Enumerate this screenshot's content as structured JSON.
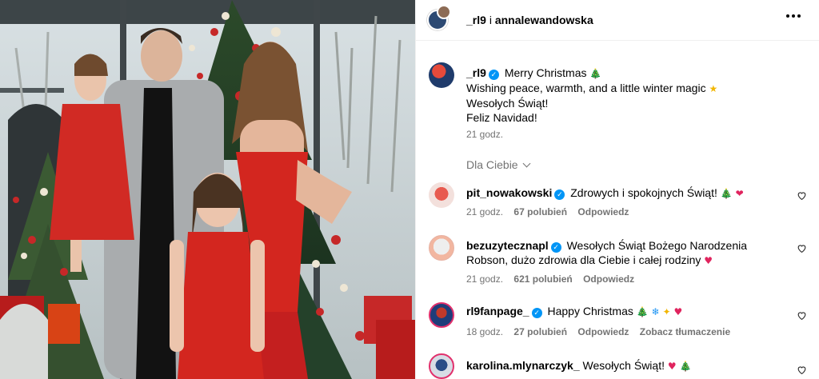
{
  "post": {
    "image_alt": "Family photo in red outfits in front of a Christmas tree",
    "header": {
      "user1": "_rl9",
      "joiner": "i",
      "user2": "annalewandowska"
    },
    "caption": {
      "username": "_rl9",
      "line1": "Merry Christmas",
      "line2": "Wishing peace, warmth, and a little winter magic",
      "line3": "Wesołych Świąt!",
      "line4": "Feliz Navidad!",
      "time": "21 godz."
    },
    "for_you_label": "Dla Ciebie"
  },
  "icons": {
    "more": "more-options-icon",
    "verified": "verified-badge-icon",
    "heart": "heart-icon",
    "chevron": "chevron-down-icon"
  },
  "colors": {
    "verified": "#0095f6",
    "muted": "#737373",
    "divider": "#efefef"
  },
  "comments": [
    {
      "username": "pit_nowakowski",
      "verified": true,
      "text": "Zdrowych i spokojnych Świąt!",
      "time": "21 godz.",
      "likes": "67 polubień",
      "reply": "Odpowiedz",
      "translate": ""
    },
    {
      "username": "bezuzytecznapl",
      "verified": true,
      "text": "Wesołych Świąt Bożego Narodzenia Robson, dużo zdrowia dla Ciebie i całej rodziny",
      "time": "21 godz.",
      "likes": "621 polubień",
      "reply": "Odpowiedz",
      "translate": ""
    },
    {
      "username": "rl9fanpage_",
      "verified": true,
      "text": "Happy Christmas",
      "time": "18 godz.",
      "likes": "27 polubień",
      "reply": "Odpowiedz",
      "translate": "Zobacz tłumaczenie"
    },
    {
      "username": "karolina.mlynarczyk_",
      "verified": false,
      "text": "Wesołych Świąt!",
      "time": "",
      "likes": "",
      "reply": "",
      "translate": ""
    }
  ]
}
